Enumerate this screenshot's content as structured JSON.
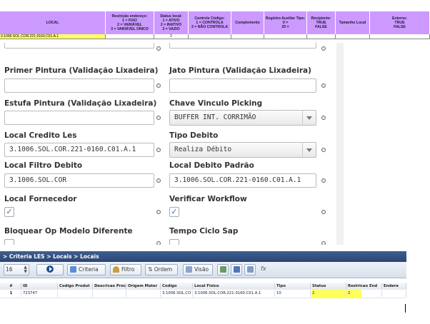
{
  "sheet": {
    "headers": [
      {
        "text": "LOCAL"
      },
      {
        "text": "Restrição endereço:\n1 = FIXO\n2 = VARIÁVEL\n3 = VARIÁVEL ÚNICO"
      },
      {
        "text": "Status local:\n1 = ATIVO\n2 = INATIVO\n3 = VAZIO"
      },
      {
        "text": "Controle Código:\n1 = CONTROLA\n3 = NÃO CONTROLA"
      },
      {
        "text": "Complemento"
      },
      {
        "text": "Registro Auxiliar Tipo:\n0 =\n20 ="
      },
      {
        "text": "Recipiente:\nTRUE\nFALSE"
      },
      {
        "text": "Tamanho Local"
      },
      {
        "text": "Externo:\nTRUE\nFALSE"
      }
    ],
    "row": {
      "local": "3.1006.SOL.COR.221-0160.C01.A.1",
      "status": "2"
    }
  },
  "form": {
    "primer_label": "Primer Pintura (Validação Lixadeira)",
    "primer_value": "",
    "jato_label": "Jato Pintura (Validação Lixadeira)",
    "jato_value": "",
    "estufa_label": "Estufa Pintura (Validação Lixadeira)",
    "estufa_value": "",
    "chave_label": "Chave Vinculo Picking",
    "chave_value": "BUFFER INT. CORRIMÃO",
    "credito_label": "Local Credito Les",
    "credito_value": "3.1006.SOL.COR.221-0160.C01.A.1",
    "tipo_debito_label": "Tipo Debito",
    "tipo_debito_value": "Realiza Débito",
    "filtro_debito_label": "Local Filtro Debito",
    "filtro_debito_value": "3.1006.SOL.COR",
    "debito_padrao_label": "Local Debito Padrão",
    "debito_padrao_value": "3.1006.SOL.COR.221-0160.C01.A.1",
    "fornecedor_label": "Local Fornecedor",
    "workflow_label": "Verificar Workflow",
    "bloquear_label": "Bloquear Op Modelo Diferente",
    "tempo_ciclo_label": "Tempo Ciclo Sap",
    "check_mark": "✓"
  },
  "grid": {
    "breadcrumb": "> Criteria LES > Locais > Locais",
    "page_size": "16",
    "buttons": {
      "criteria": "Criteria",
      "filtro": "Filtro",
      "ordem": "Ordem",
      "visao": "Visão"
    },
    "columns": [
      "#",
      "ID",
      "Codigo Produt",
      "Descricao Proc",
      "Origem Mater",
      "Codigo",
      "Local Fisico",
      "Tipo",
      "Status",
      "Restricao End",
      "Endere"
    ],
    "rows": [
      {
        "num": "1",
        "id": "723747",
        "codigo_produto": "",
        "descricao": "",
        "origem": "",
        "codigo": "3.1006.SOL.CO",
        "local_fisico": "3.1006.SOL.COR.221-0160.C01.A.1",
        "tipo": "10",
        "status": "2",
        "restricao": "2",
        "endereco": ""
      }
    ]
  },
  "colors": {
    "header_purple": "#cc99ff",
    "highlight_yellow": "#ffff33",
    "breadcrumb_blue": "#2a4674"
  }
}
